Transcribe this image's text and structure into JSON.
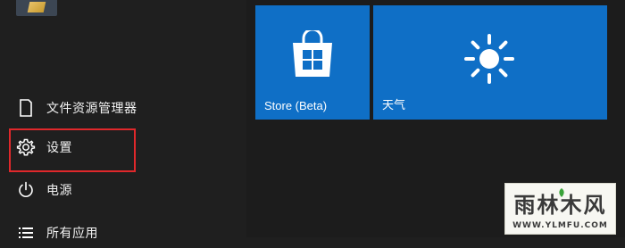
{
  "start_menu": {
    "items": [
      {
        "id": "explorer",
        "label": "文件资源管理器",
        "icon": "file-explorer-icon"
      },
      {
        "id": "settings",
        "label": "设置",
        "icon": "gear-icon"
      },
      {
        "id": "power",
        "label": "电源",
        "icon": "power-icon"
      },
      {
        "id": "allapps",
        "label": "所有应用",
        "icon": "list-icon"
      }
    ],
    "highlight_color": "#e0282b"
  },
  "tiles": [
    {
      "id": "store",
      "label": "Store (Beta)",
      "icon": "store-bag-icon",
      "color": "#0f6fc6"
    },
    {
      "id": "weather",
      "label": "天气",
      "icon": "sun-icon",
      "color": "#0f6fc6"
    }
  ],
  "watermark": {
    "title": "雨林木风",
    "url": "WWW.YLMFU.COM"
  }
}
